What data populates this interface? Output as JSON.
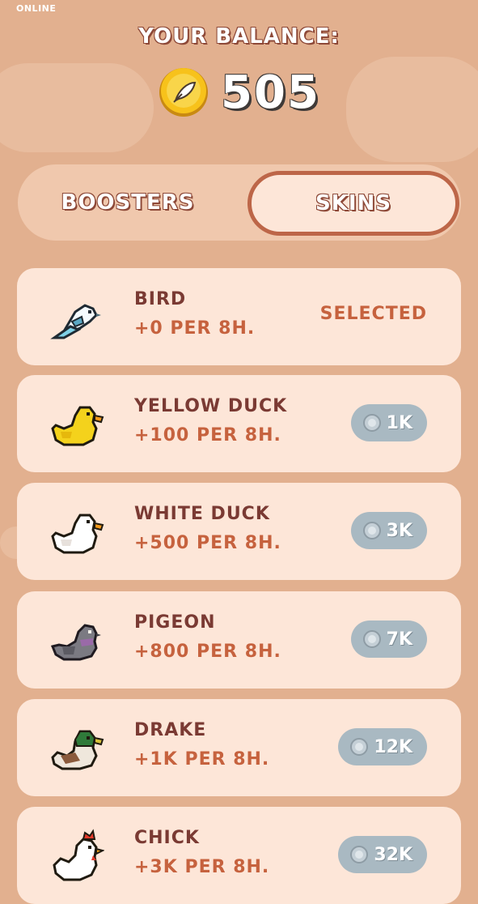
{
  "status": {
    "label": "ONLINE"
  },
  "header": {
    "title": "YOUR BALANCE:",
    "balance": "505",
    "coin_icon": "coin-feather-icon"
  },
  "tabs": [
    {
      "label": "BOOSTERS",
      "active": false
    },
    {
      "label": "SKINS",
      "active": true
    }
  ],
  "skins": [
    {
      "name": "BIRD",
      "rate": "+0 PER 8H.",
      "selected_label": "SELECTED",
      "icon": "bird-icon"
    },
    {
      "name": "YELLOW DUCK",
      "rate": "+100 PER 8H.",
      "price": "1K",
      "icon": "yellow-duck-icon"
    },
    {
      "name": "WHITE DUCK",
      "rate": "+500 PER 8H.",
      "price": "3K",
      "icon": "white-duck-icon"
    },
    {
      "name": "PIGEON",
      "rate": "+800 PER 8H.",
      "price": "7K",
      "icon": "pigeon-icon"
    },
    {
      "name": "DRAKE",
      "rate": "+1K PER 8H.",
      "price": "12K",
      "icon": "drake-icon"
    },
    {
      "name": "CHICK",
      "rate": "+3K PER 8H.",
      "price": "32K",
      "icon": "chick-icon"
    }
  ],
  "colors": {
    "background": "#e2b08f",
    "card": "#fde6d8",
    "accent": "#c6623e",
    "title_text": "#7a3a33",
    "price_button": "#a9b9c2"
  }
}
